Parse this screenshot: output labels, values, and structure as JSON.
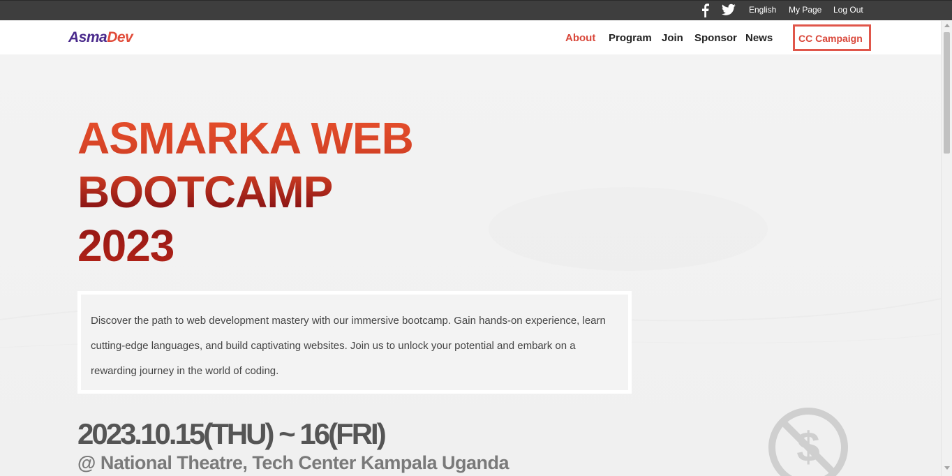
{
  "topbar": {
    "icons": [
      "facebook-icon",
      "twitter-icon"
    ],
    "links": [
      "English",
      "My Page",
      "Log Out"
    ]
  },
  "navbar": {
    "logo_part1": "Asma",
    "logo_part2": "Dev",
    "items": [
      "About",
      "Program",
      "Join",
      "Sponsor",
      "News"
    ],
    "cta": "CC Campaign",
    "active_color": "#d9473a",
    "logo_colors": [
      "#4a2a8c",
      "#e14c3a"
    ]
  },
  "hero": {
    "title_lines": [
      "ASMARKA WEB",
      "BOOTCAMP",
      "2023"
    ],
    "description": "Discover the path to web development mastery with our immersive bootcamp. Gain hands-on experience, learn cutting-edge languages, and build captivating websites. Join us to unlock your potential and embark on a rewarding journey in the world of coding.",
    "date": "2023.10.15(THU) ~ 16(FRI)",
    "venue": "@ National Theatre, Tech Center Kampala Uganda",
    "decorative_icon": "no-dollar-icon"
  }
}
